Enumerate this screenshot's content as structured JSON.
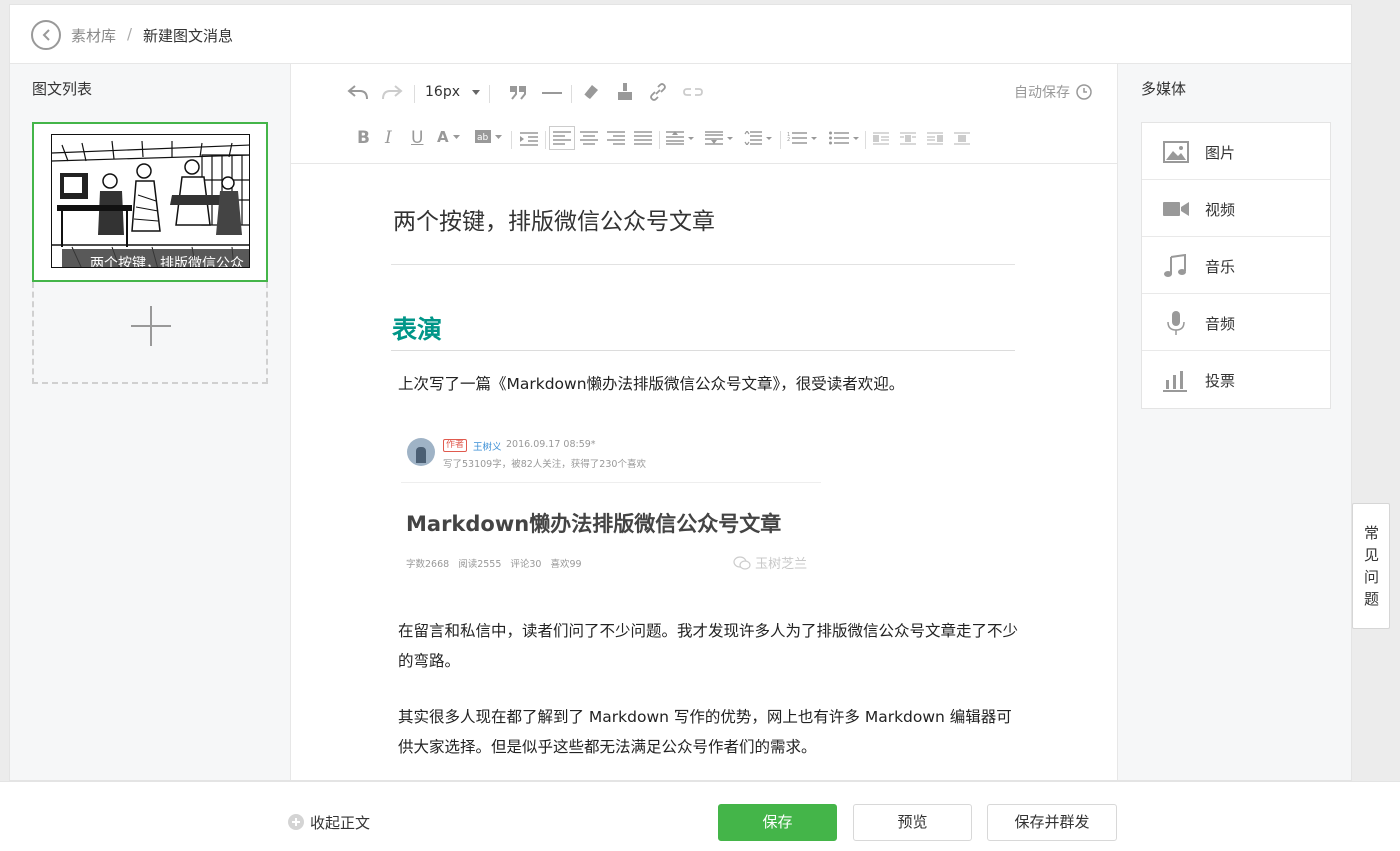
{
  "breadcrumb": {
    "parent": "素材库",
    "separator": "/",
    "current": "新建图文消息"
  },
  "left_panel": {
    "title": "图文列表",
    "items": [
      {
        "caption": "两个按键，排版微信公众"
      }
    ]
  },
  "toolbar": {
    "font_size": "16px",
    "autosave": "自动保存"
  },
  "article": {
    "title": "两个按键，排版微信公众号文章",
    "section_heading": "表演",
    "heading_color": "#009688",
    "paragraphs": [
      "上次写了一篇《Markdown懒办法排版微信公众号文章》，很受读者欢迎。",
      "在留言和私信中，读者们问了不少问题。我才发现许多人为了排版微信公众号文章走了不少的弯路。",
      "其实很多人现在都了解到了 Markdown 写作的优势，网上也有许多 Markdown 编辑器可供大家选择。但是似乎这些都无法满足公众号作者们的需求。"
    ],
    "embed": {
      "author_tag": "作者",
      "author_name": "王树义",
      "date": "2016.09.17 08:59*",
      "author_stats": "写了53109字，被82人关注，获得了230个喜欢",
      "title": "Markdown懒办法排版微信公众号文章",
      "meta": "字数2668 阅读2555 评论30 喜欢99",
      "watermark": "玉树芝兰"
    }
  },
  "right_panel": {
    "title": "多媒体",
    "items": [
      {
        "label": "图片",
        "icon": "image-icon"
      },
      {
        "label": "视频",
        "icon": "video-icon"
      },
      {
        "label": "音乐",
        "icon": "music-icon"
      },
      {
        "label": "音频",
        "icon": "microphone-icon"
      },
      {
        "label": "投票",
        "icon": "poll-icon"
      }
    ]
  },
  "faq": {
    "label": "常见问题"
  },
  "bottom": {
    "collapse_label": "收起正文",
    "save": "保存",
    "preview": "预览",
    "save_and_send": "保存并群发",
    "accent_color": "#44b549"
  }
}
